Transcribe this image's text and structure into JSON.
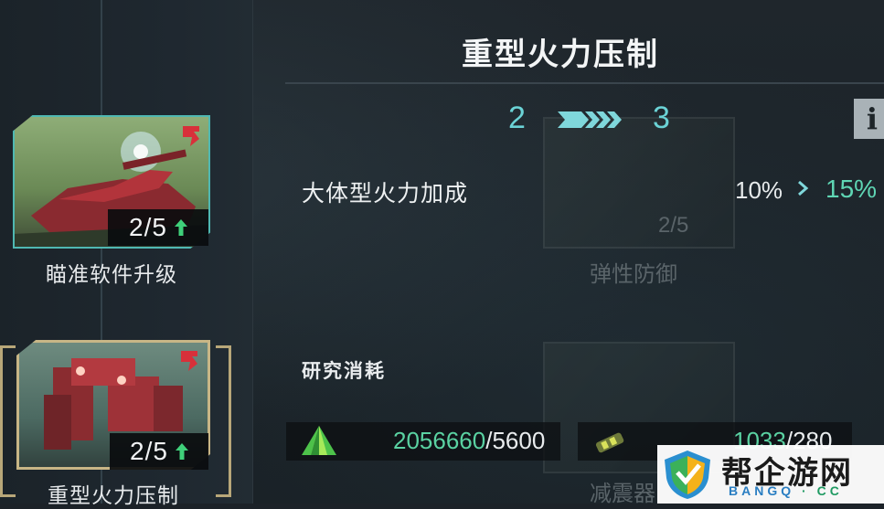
{
  "panel": {
    "title": "重型火力压制",
    "level_from": "2",
    "level_to": "3",
    "info_label": "i",
    "stat": {
      "label": "大体型火力加成",
      "old": "10%",
      "new": "15%"
    },
    "cost_title": "研究消耗",
    "costs": [
      {
        "icon": "green-crystal-icon",
        "have": "2056660",
        "sep": "/",
        "need": "5600"
      },
      {
        "icon": "shock-absorber-part-icon",
        "have": "1033",
        "sep": "/",
        "need": "280"
      }
    ]
  },
  "tree": {
    "nodes": [
      {
        "name": "瞄准软件升级",
        "level": "2/5",
        "selected": false
      },
      {
        "name": "重型火力压制",
        "level": "2/5",
        "selected": true
      }
    ],
    "ghost_nodes": [
      {
        "name": "弹性防御",
        "level": "2/5"
      },
      {
        "name": "减震器"
      }
    ]
  },
  "watermark": {
    "title": "帮企游网",
    "sub_a": "BANGQ",
    "sub_dot": "·",
    "sub_b": "CC"
  },
  "colors": {
    "accent_cyan": "#6bd3d6",
    "increase_green": "#5fd6b4",
    "upgrade_arrow": "#3fd07a",
    "selection_gold": "#b8a779",
    "alert_red": "#d8303a"
  }
}
